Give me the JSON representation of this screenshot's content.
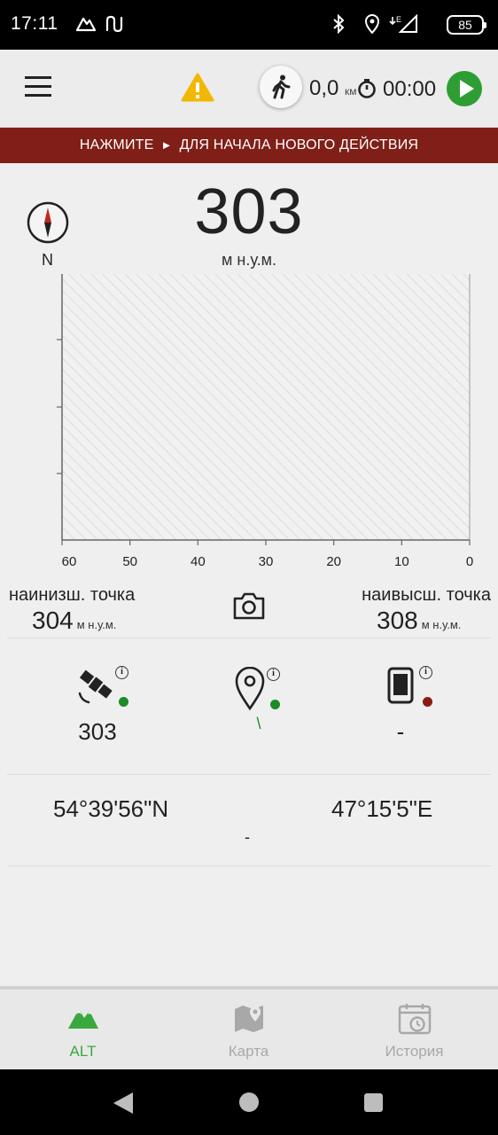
{
  "status_bar": {
    "time": "17:11",
    "battery": "85",
    "icons": [
      "mountain-icon",
      "route-icon",
      "bluetooth-icon",
      "location-icon",
      "signal-icon"
    ]
  },
  "toolbar": {
    "distance_value": "0,0",
    "distance_unit": "км",
    "timer": "00:00"
  },
  "banner": {
    "prefix": "НАЖМИТЕ",
    "symbol": "►",
    "suffix": "ДЛЯ НАЧАЛА НОВОГО ДЕЙСТВИЯ"
  },
  "altitude": {
    "compass_label": "N",
    "value": "303",
    "unit": "м н.у.м."
  },
  "chart_data": {
    "type": "area",
    "x_ticks": [
      "60",
      "50",
      "40",
      "30",
      "20",
      "10",
      "0"
    ],
    "series": [],
    "grid": false
  },
  "min_max": {
    "low_label": "наинизш. точка",
    "low_value": "304",
    "low_unit": "м н.у.м.",
    "high_label": "наивысш. точка",
    "high_value": "308",
    "high_unit": "м н.у.м."
  },
  "sources": {
    "info_glyph": "i",
    "gps_value": "303",
    "location_value": "\\",
    "device_value": "-",
    "colors": {
      "active": "#1e8a2a",
      "inactive": "#8a1c12"
    }
  },
  "coordinates": {
    "lat": "54°39'56\"N",
    "lon": "47°15'5\"E",
    "extra": "-"
  },
  "bottom_nav": {
    "alt": "ALT",
    "map": "Карта",
    "history": "История",
    "active_color": "#3aa83f",
    "inactive_color": "#a8a8a8"
  }
}
